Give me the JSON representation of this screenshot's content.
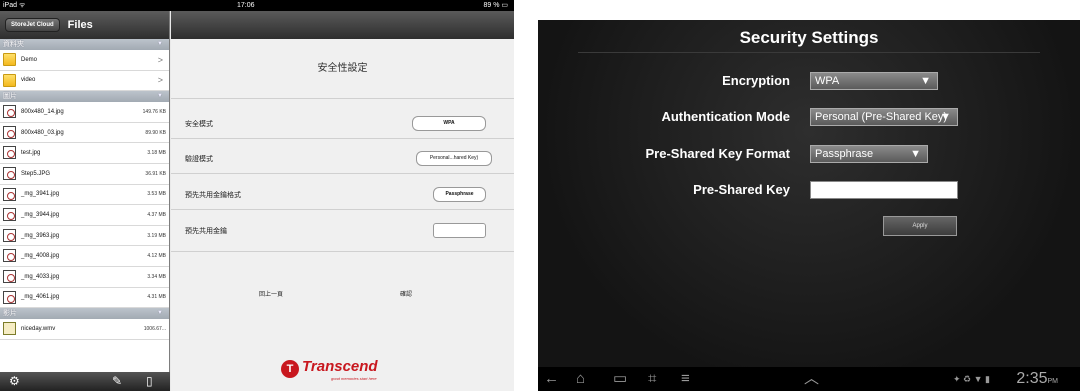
{
  "ipad": {
    "status": {
      "carrier": "iPad ᯤ",
      "time": "17:06",
      "battery": "89 % ▭"
    },
    "sidebar": {
      "cloud_button": "StoreJet Cloud",
      "title": "Files",
      "sections": [
        {
          "header": "資料夾",
          "type": "folder",
          "items": [
            {
              "name": "Demo"
            },
            {
              "name": "video"
            }
          ]
        },
        {
          "header": "圖片",
          "type": "image",
          "items": [
            {
              "name": "800x480_14.jpg",
              "size": "149.76 KB"
            },
            {
              "name": "800x480_03.jpg",
              "size": "89.90 KB"
            },
            {
              "name": "test.jpg",
              "size": "3.18 MB"
            },
            {
              "name": "Step5.JPG",
              "size": "36.91 KB"
            },
            {
              "name": "_mg_3941.jpg",
              "size": "3.53 MB"
            },
            {
              "name": "_mg_3944.jpg",
              "size": "4.37 MB"
            },
            {
              "name": "_mg_3963.jpg",
              "size": "3.19 MB"
            },
            {
              "name": "_mg_4008.jpg",
              "size": "4.12 MB"
            },
            {
              "name": "_mg_4033.jpg",
              "size": "3.34 MB"
            },
            {
              "name": "_mg_4061.jpg",
              "size": "4.31 MB"
            }
          ]
        },
        {
          "header": "影片",
          "type": "video",
          "items": [
            {
              "name": "niceday.wmv",
              "size": "1006.67..."
            }
          ]
        }
      ],
      "toolbar": {
        "settings": "⚙",
        "edit": "✎",
        "device": "▯"
      }
    },
    "detail": {
      "title": "安全性設定",
      "rows": [
        {
          "label": "安全模式",
          "value": "WPA"
        },
        {
          "label": "驗證模式",
          "value": "Personal...hared Key)"
        },
        {
          "label": "預先共用金鑰格式",
          "value": "Passphrase"
        },
        {
          "label": "預先共用金鑰",
          "value": ""
        }
      ],
      "back_button": "回上一頁",
      "confirm_button": "確認",
      "brand": {
        "name": "Transcend",
        "tagline": "good memories start here"
      }
    }
  },
  "android": {
    "title": "Security Settings",
    "fields": [
      {
        "label": "Encryption",
        "value": "WPA"
      },
      {
        "label": "Authentication Mode",
        "value": "Personal (Pre-Shared Key)"
      },
      {
        "label": "Pre-Shared Key Format",
        "value": "Passphrase"
      },
      {
        "label": "Pre-Shared Key",
        "value": ""
      }
    ],
    "apply_button": "Apply",
    "navbar": {
      "back": "←",
      "home": "⌂",
      "recents": "▭",
      "screenshot": "⌗",
      "menu": "≡",
      "up": "︿",
      "time": "2:35",
      "ampm": "PM",
      "status_icons": "✦ ♻ ▼ ▮"
    }
  }
}
